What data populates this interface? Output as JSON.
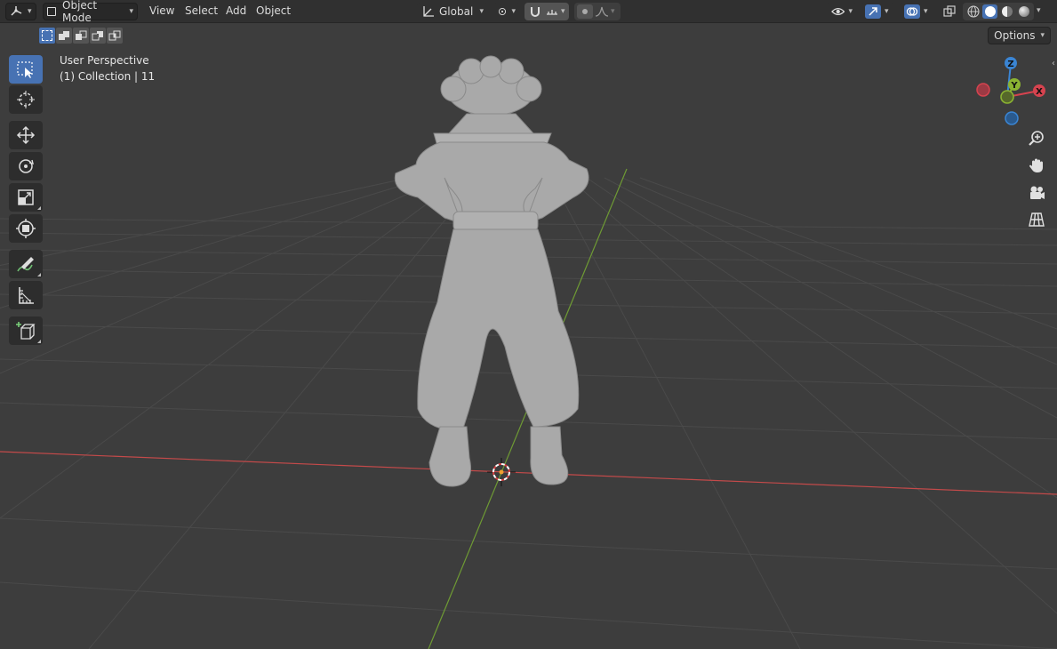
{
  "header": {
    "editor_type_icon": "3d-viewport-icon",
    "mode_label": "Object Mode",
    "menus": [
      "View",
      "Select",
      "Add",
      "Object"
    ],
    "transform_orientation": "Global",
    "options_label": "Options"
  },
  "select_modes": [
    "set",
    "extend",
    "subtract",
    "difference",
    "intersect"
  ],
  "toolbar": {
    "tools": [
      "select-box",
      "cursor",
      "move",
      "rotate",
      "scale",
      "transform",
      "annotate",
      "measure",
      "add-cube"
    ],
    "active": "select-box"
  },
  "viewport": {
    "view_name": "User Perspective",
    "collection_info": "(1) Collection | 11"
  },
  "gizmo": {
    "labels": {
      "z": "Z",
      "y": "Y",
      "x": "X"
    },
    "colors": {
      "x": "#d6434f",
      "y": "#8bb332",
      "z": "#3a85d4"
    }
  },
  "nav_icons": [
    "zoom-icon",
    "pan-hand-icon",
    "camera-icon",
    "ortho-grid-icon"
  ],
  "colors": {
    "background": "#3d3d3d",
    "header": "#303030",
    "active": "#4772b3",
    "x_axis": "#c44a4a",
    "y_axis": "#6e9a34",
    "model": "#a9a9a9"
  }
}
